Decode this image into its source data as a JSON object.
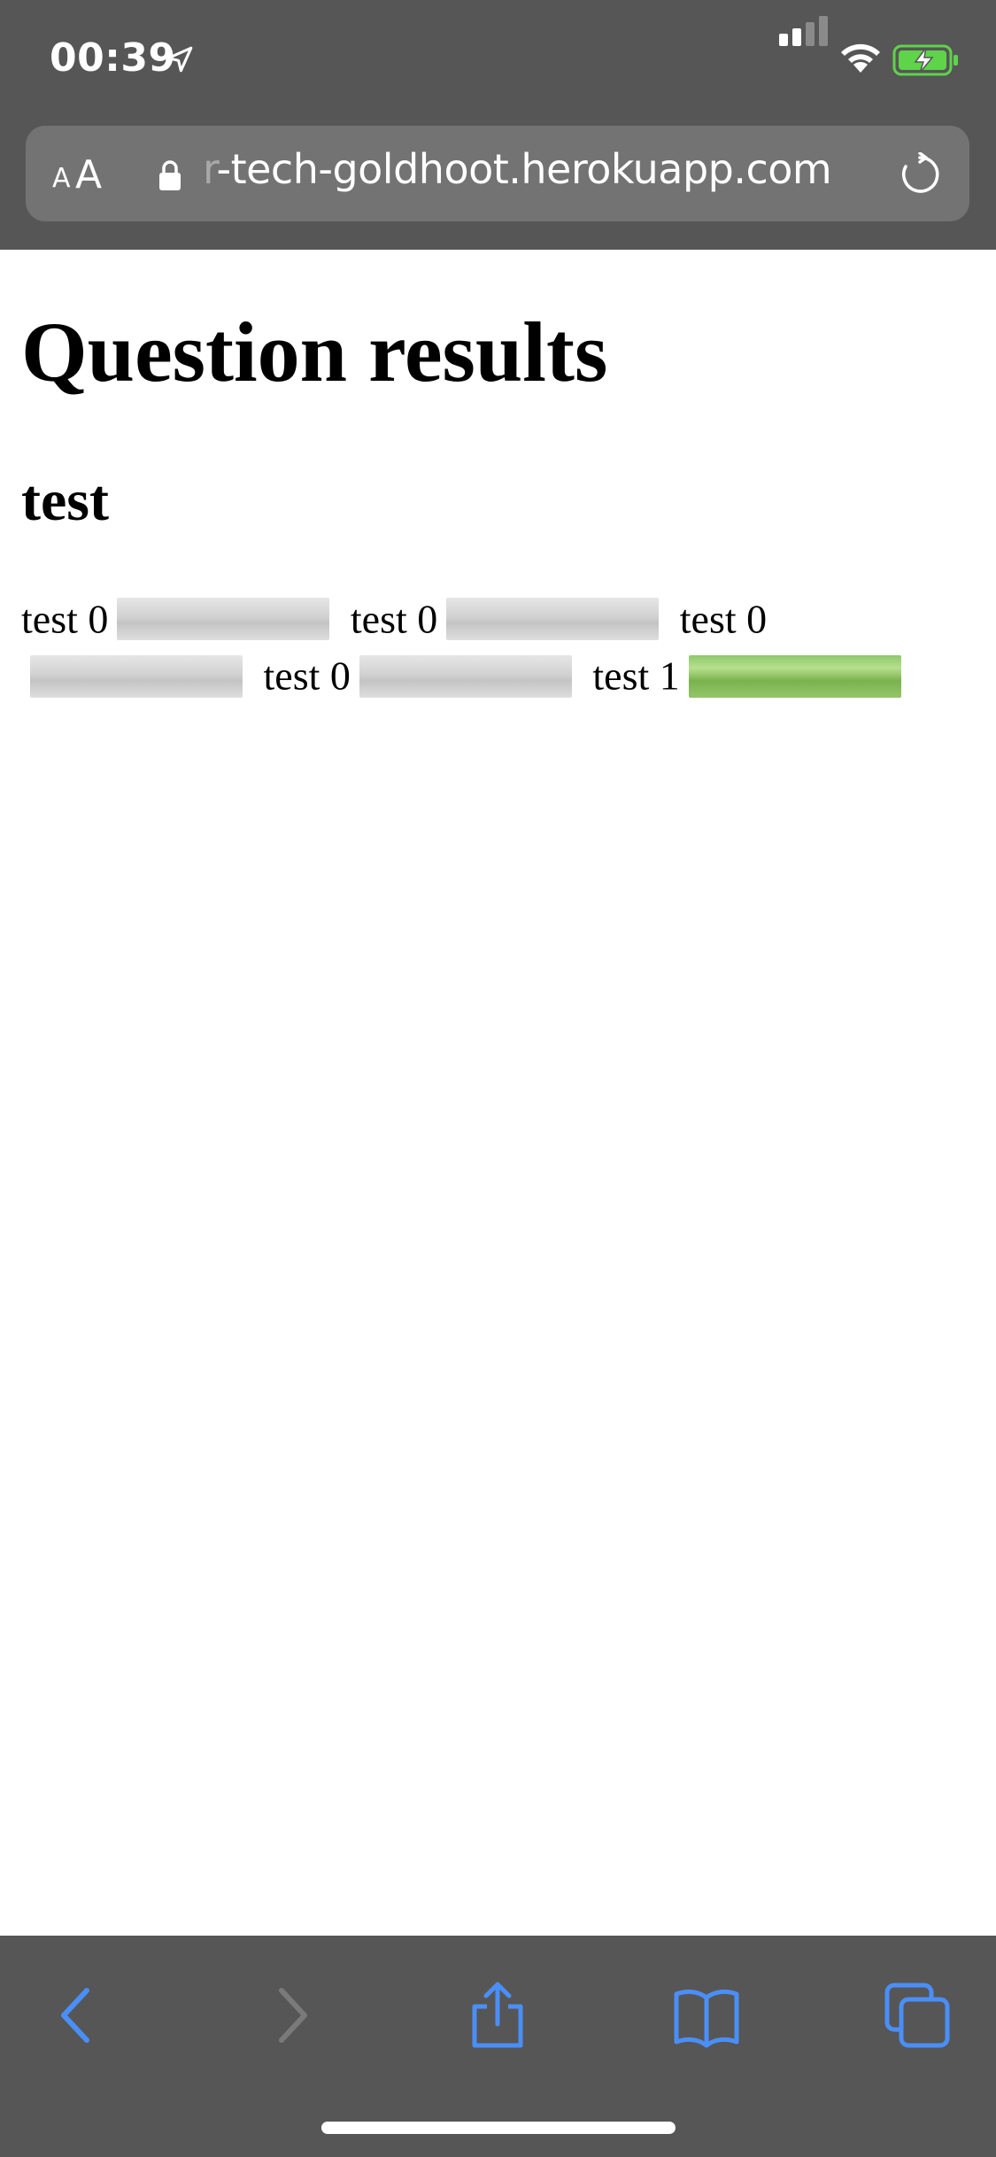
{
  "status_bar": {
    "time": "00:39",
    "location_icon": "location-arrow-icon",
    "signal_icon": "cellular-signal-icon",
    "wifi_icon": "wifi-icon",
    "battery_icon": "battery-charging-icon",
    "battery_color": "#5fd34a"
  },
  "url_bar": {
    "text_size_label_small": "A",
    "text_size_label_big": "A",
    "url_faded_prefix": "r",
    "url": "-tech-goldhoot.herokuapp.com",
    "lock_icon": "lock-icon",
    "reload_icon": "reload-icon"
  },
  "page": {
    "title": "Question results",
    "question": "test",
    "results": [
      {
        "label": "test 0",
        "fraction": 0
      },
      {
        "label": "test 0",
        "fraction": 0
      },
      {
        "label": "test 0",
        "fraction": 0
      },
      {
        "label": "test 0",
        "fraction": 0
      },
      {
        "label": "test 1",
        "fraction": 1
      }
    ]
  },
  "toolbar": {
    "accent_color": "#4a8ff7",
    "items": [
      "back-icon",
      "forward-icon",
      "share-icon",
      "bookmarks-icon",
      "tabs-icon"
    ]
  }
}
